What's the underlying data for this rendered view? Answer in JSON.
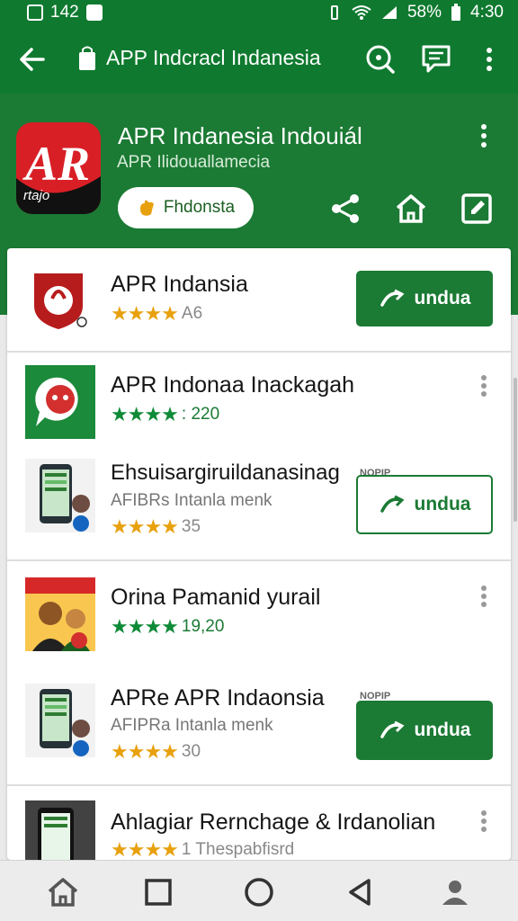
{
  "status_bar": {
    "left_text": "142",
    "battery": "58%",
    "time": "4:30"
  },
  "app_bar": {
    "title": "APP Indcracl Indanesia",
    "icons": [
      "back-arrow-icon",
      "shopping-bag-icon",
      "search-icon",
      "chat-icon",
      "more-vert-icon"
    ]
  },
  "hero": {
    "logo_text": "AR",
    "logo_small": "rtajo",
    "title": "APR Indanesia Indouiál",
    "subtitle": "APR Ilidouallamecia",
    "chip_label": "Fhdonsta",
    "actions": [
      "share-icon",
      "home-icon",
      "edit-icon"
    ]
  },
  "items": [
    {
      "title": "APR Indansia",
      "rating_stars": "★★★★",
      "rating_text": "A6",
      "button": "undua"
    },
    {
      "title": "APR Indonaa Inackagah",
      "rating_stars": "★★★★",
      "rating_text": ": 220"
    },
    {
      "title": "Ehsuisargiruildanasinag",
      "subtitle": "AFIBRs Intanla menk",
      "rating_stars": "★★★★",
      "rating_text": "35",
      "tag": "NOPIP",
      "button": "undua"
    },
    {
      "title": "Orina Pamanid yurail",
      "rating_stars": "★★★★",
      "rating_text": "19,20"
    },
    {
      "title": "APRe APR Indaonsia",
      "subtitle": "AFIPRa Intanla menk",
      "rating_stars": "★★★★",
      "rating_text": "30",
      "tag": "NOPIP",
      "button": "undua"
    },
    {
      "title": "Ahlagiar Rernchage & Irdanolian",
      "rating_stars": "★★★★",
      "rating_text": "1 Thespabfisrd"
    }
  ],
  "nav_bar": {
    "icons": [
      "home-nav-icon",
      "recent-apps-icon",
      "home-circle-icon",
      "back-triangle-icon",
      "profile-icon"
    ]
  },
  "colors": {
    "primary_green": "#0f7a2f",
    "hero_green": "#1b7a34",
    "star_gold": "#e8a10e",
    "star_green": "#0f8a37",
    "logo_red": "#d91f26"
  }
}
